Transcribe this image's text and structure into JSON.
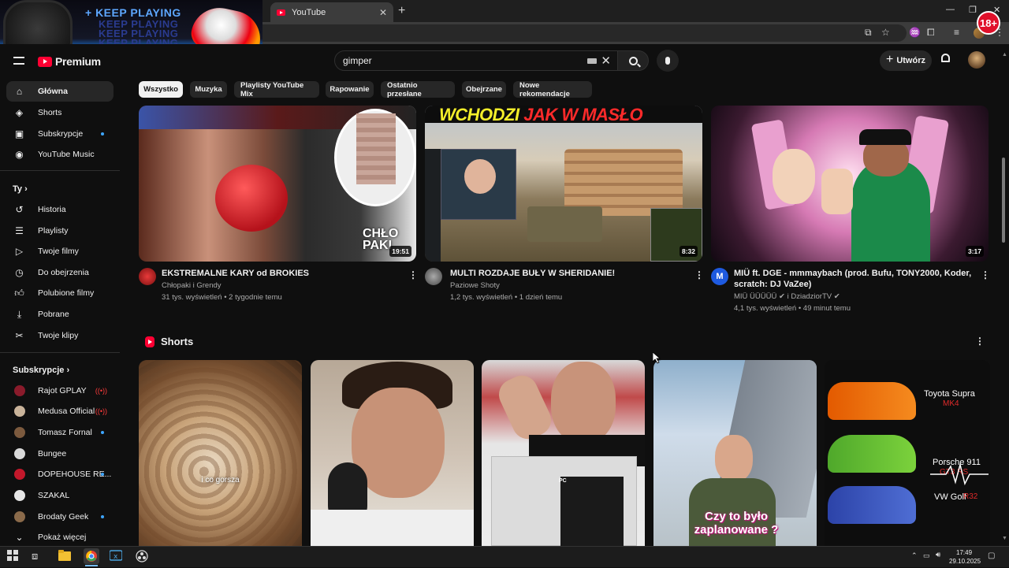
{
  "browser": {
    "tab_title": "YouTube",
    "tab_close": "✕",
    "new_tab": "+",
    "win_min": "—",
    "win_max": "❐",
    "win_close": "✕",
    "age_badge": "18+"
  },
  "ad": {
    "headline": "+ KEEP PLAYING",
    "echo_1": "KEEP PLAYING",
    "echo_2": "KEEP PLAYING",
    "echo_3": "KEEP PLAYING"
  },
  "header": {
    "brand": "Premium",
    "search_value": "gimper",
    "create_label": "Utwórz"
  },
  "sidebar": {
    "main": [
      {
        "label": "Główna",
        "icon": "home-icon"
      },
      {
        "label": "Shorts",
        "icon": "shorts-icon"
      },
      {
        "label": "Subskrypcje",
        "icon": "subscriptions-icon"
      },
      {
        "label": "YouTube Music",
        "icon": "music-icon"
      }
    ],
    "you_heading": "Ty",
    "you": [
      {
        "label": "Historia",
        "icon": "history-icon"
      },
      {
        "label": "Playlisty",
        "icon": "playlists-icon"
      },
      {
        "label": "Twoje filmy",
        "icon": "your-videos-icon"
      },
      {
        "label": "Do obejrzenia",
        "icon": "watch-later-icon"
      },
      {
        "label": "Polubione filmy",
        "icon": "liked-icon"
      },
      {
        "label": "Pobrane",
        "icon": "downloads-icon"
      },
      {
        "label": "Twoje klipy",
        "icon": "clips-icon"
      }
    ],
    "subs_heading": "Subskrypcje",
    "subs": [
      {
        "label": "Rajot GPLAY",
        "indicator": "live",
        "color": "#8a1b2b"
      },
      {
        "label": "Medusa Official",
        "indicator": "live",
        "color": "#c9b39a"
      },
      {
        "label": "Tomasz Fornal",
        "indicator": "dot",
        "color": "#7c5a3e"
      },
      {
        "label": "Bungee",
        "indicator": "none",
        "color": "#d9d9d9"
      },
      {
        "label": "DOPEHOUSE RE...",
        "indicator": "dot",
        "color": "#c3182b"
      },
      {
        "label": "SZAKAL",
        "indicator": "none",
        "color": "#e6e6e6"
      },
      {
        "label": "Brodaty Geek",
        "indicator": "dot",
        "color": "#8a6a4a"
      }
    ],
    "more_label": "Pokaż więcej"
  },
  "chips": [
    "Wszystko",
    "Muzyka",
    "Playlisty YouTube Mix",
    "Rapowanie",
    "Ostatnio przesłane",
    "Obejrzane",
    "Nowe rekomendacje"
  ],
  "videos": [
    {
      "title": "EKSTREMALNE KARY od BROKIES",
      "channel": "Chłopaki i Grendy",
      "stats": "31 tys. wyświetleń • 2 tygodnie temu",
      "duration": "19:51",
      "thumb_text": "CHŁO PAKI"
    },
    {
      "title": "MULTI ROZDAJE BUŁY W SHERIDANIE!",
      "channel": "Paziowe Shoty",
      "stats": "1,2 tys. wyświetleń • 1 dzień temu",
      "duration": "8:32",
      "thumb_text_a": "WCHODZI ",
      "thumb_text_b": "JAK W MASŁO"
    },
    {
      "title_line1": "MIÜ ft. DGE - mmmaybach (prod. Bufu, TONY2000, Koder,",
      "title_line2": "scratch: DJ VaZee)",
      "channel_a": "MIÜ ÜÜÜÜÜ",
      "channel_b": "i DziadziorTV",
      "stats": "4,1 tys. wyświetleń • 49 minut temu",
      "duration": "3:17",
      "avatar_letter": "M"
    }
  ],
  "shorts": {
    "heading": "Shorts",
    "items": [
      {
        "caption": "i co gorsza"
      },
      {
        "caption": ""
      },
      {
        "caption": "PC"
      },
      {
        "caption": "Czy to było zaplanowane ?"
      },
      {
        "cars": [
          "Toyota Supra",
          "MK4",
          "Porsche 911",
          "GT3 RS",
          "VW Golf",
          "R32"
        ]
      }
    ]
  },
  "taskbar": {
    "time": "17:49",
    "date": "29.10.2025"
  },
  "colors": {
    "background": "#0f0f0f",
    "accent_red": "#ff0033",
    "chip_bg": "#272727",
    "text_secondary": "#aaaaaa"
  }
}
